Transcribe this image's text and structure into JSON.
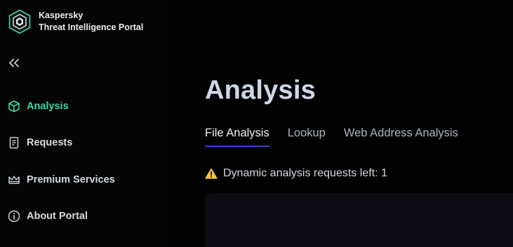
{
  "brand": {
    "name": "Kaspersky",
    "product": "Threat Intelligence Portal",
    "logo_icon": "kaspersky-hex-logo-icon"
  },
  "sidebar": {
    "collapse_icon": "double-chevron-left-icon",
    "items": [
      {
        "label": "Analysis",
        "icon": "cube-icon",
        "active": true
      },
      {
        "label": "Requests",
        "icon": "document-icon",
        "active": false
      },
      {
        "label": "Premium Services",
        "icon": "crown-icon",
        "active": false
      },
      {
        "label": "About Portal",
        "icon": "info-icon",
        "active": false
      }
    ]
  },
  "main": {
    "title": "Analysis",
    "tabs": [
      {
        "label": "File Analysis",
        "active": true
      },
      {
        "label": "Lookup",
        "active": false
      },
      {
        "label": "Web Address Analysis",
        "active": false
      }
    ],
    "notice": {
      "icon": "warning-icon",
      "text": "Dynamic analysis requests left: 1"
    }
  },
  "colors": {
    "background": "#020202",
    "accent_green": "#3fd6a3",
    "tab_underline": "#3a3fcf",
    "warning": "#f5c542",
    "panel": "#0c0c12"
  }
}
